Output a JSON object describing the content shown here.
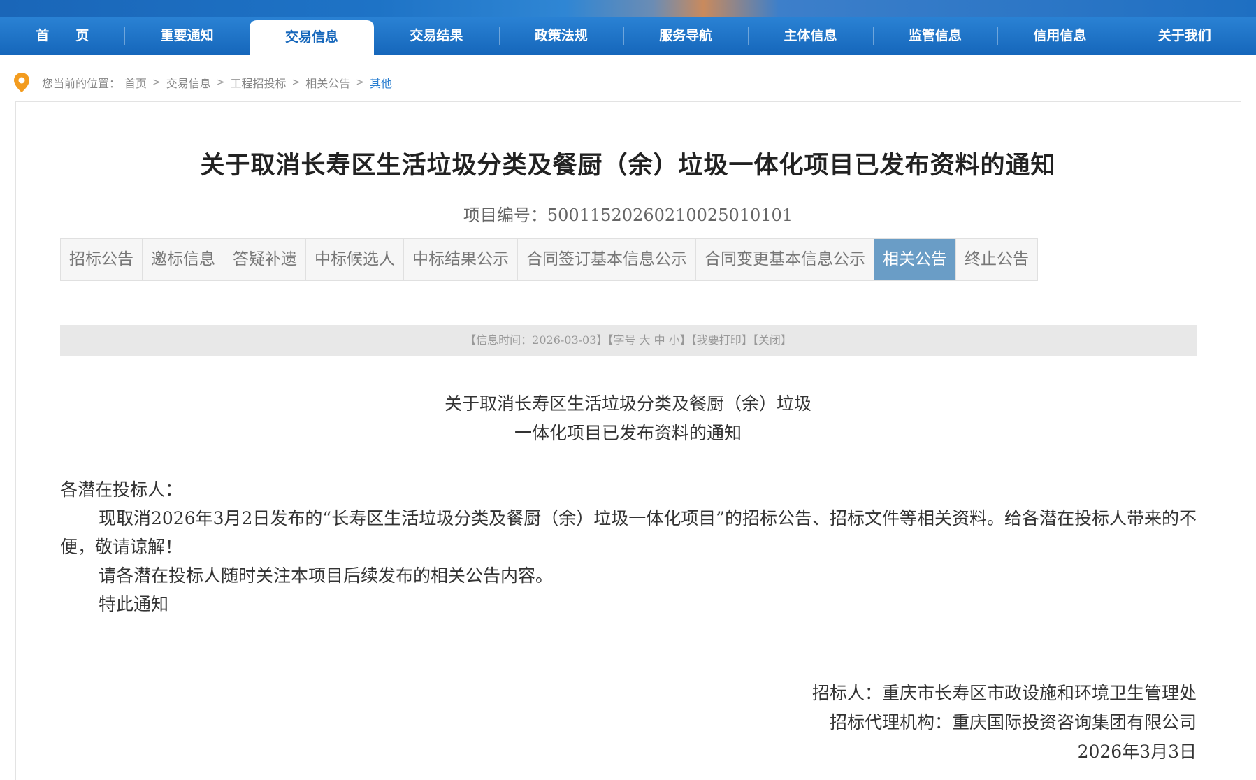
{
  "nav": {
    "items": [
      "首　　页",
      "重要通知",
      "交易信息",
      "交易结果",
      "政策法规",
      "服务导航",
      "主体信息",
      "监管信息",
      "信用信息",
      "关于我们"
    ],
    "active_index": 2
  },
  "breadcrumb": {
    "prefix": "您当前的位置：",
    "items": [
      "首页",
      "交易信息",
      "工程招投标",
      "相关公告",
      "其他"
    ],
    "separator": ">"
  },
  "notice": {
    "title": "关于取消长寿区生活垃圾分类及餐厨（余）垃圾一体化项目已发布资料的通知",
    "project_no": "项目编号：50011520260210025010101"
  },
  "tabs": {
    "items": [
      "招标公告",
      "邀标信息",
      "答疑补遗",
      "中标候选人",
      "中标结果公示",
      "合同签订基本信息公示",
      "合同变更基本信息公示",
      "相关公告",
      "终止公告"
    ],
    "active_index": 7
  },
  "infobar": {
    "open": "【",
    "date_label": "信息时间：2026-03-03",
    "mid1": "】【",
    "font_label": "字号",
    "big": "大",
    "medium": "中",
    "small": "小",
    "mid2": "】【",
    "print": "我要打印",
    "mid3": "】【",
    "close": "关闭",
    "end": "】"
  },
  "content": {
    "subtitle_line1": "关于取消长寿区生活垃圾分类及餐厨（余）垃圾",
    "subtitle_line2": "一体化项目已发布资料的通知",
    "greeting": "各潜在投标人：",
    "para1": "现取消2026年3月2日发布的“长寿区生活垃圾分类及餐厨（余）垃圾一体化项目”的招标公告、招标文件等相关资料。给各潜在投标人带来的不便，敬请谅解！",
    "para2": "请各潜在投标人随时关注本项目后续发布的相关公告内容。",
    "para3": "特此通知",
    "signer": "招标人：重庆市长寿区市政设施和环境卫生管理处",
    "agent": "招标代理机构：重庆国际投资咨询集团有限公司",
    "date": "2026年3月3日"
  },
  "colors": {
    "nav_bg": "#1667bb",
    "active_tab": "#6a9dc6",
    "breadcrumb_active": "#2b7fd0",
    "pin": "#f39c1f"
  }
}
